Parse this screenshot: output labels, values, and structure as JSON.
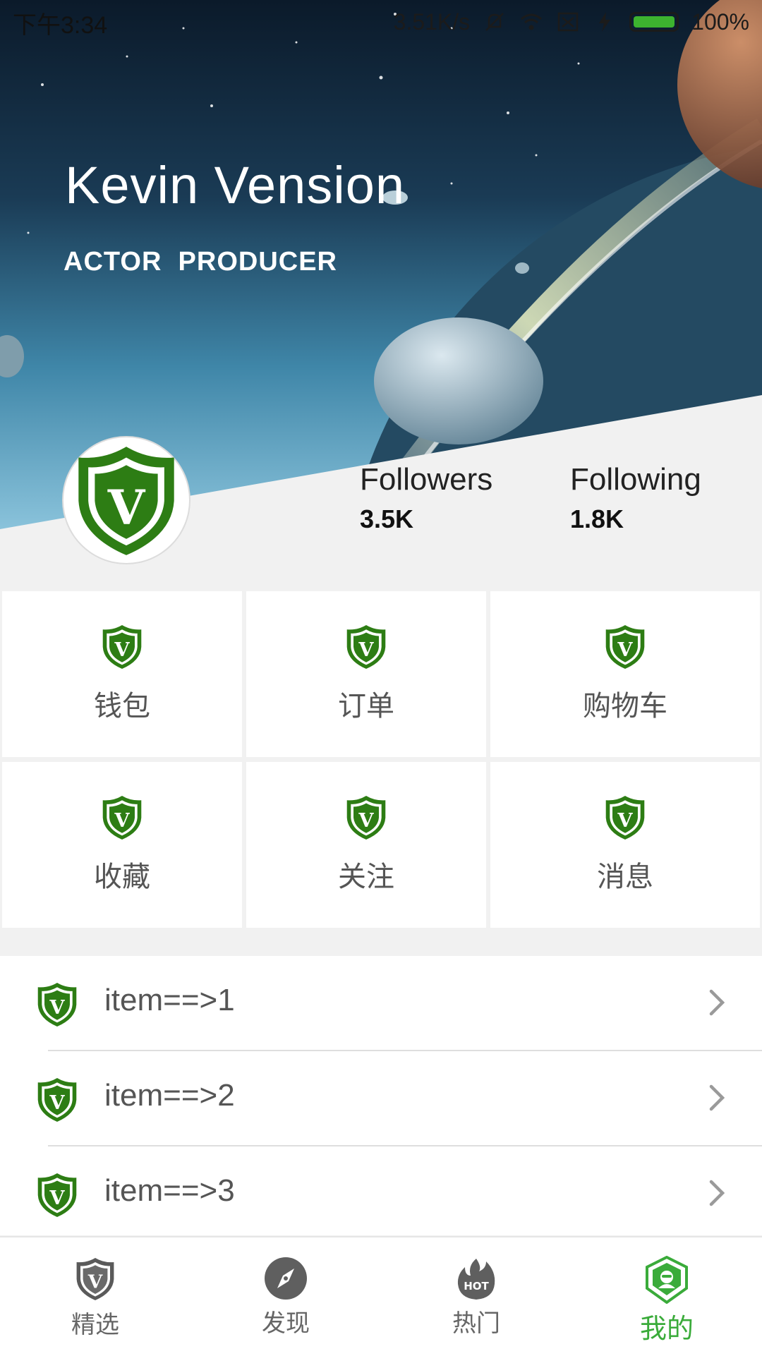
{
  "status_bar": {
    "time": "下午3:34",
    "network_speed": "3.51K/s",
    "battery": "100%",
    "icons": [
      "mute-icon",
      "wifi-icon",
      "sim-icon",
      "charging-icon",
      "battery-icon"
    ]
  },
  "profile": {
    "name": "Kevin Vension",
    "roles": "ACTOR  PRODUCER",
    "avatar_icon": "shield-v-icon",
    "followers_label": "Followers",
    "followers_value": "3.5K",
    "following_label": "Following",
    "following_value": "1.8K"
  },
  "grid": [
    {
      "label": "钱包",
      "icon": "shield-v-icon"
    },
    {
      "label": "订单",
      "icon": "shield-v-icon"
    },
    {
      "label": "购物车",
      "icon": "shield-v-icon"
    },
    {
      "label": "收藏",
      "icon": "shield-v-icon"
    },
    {
      "label": "关注",
      "icon": "shield-v-icon"
    },
    {
      "label": "消息",
      "icon": "shield-v-icon"
    }
  ],
  "list": [
    {
      "label": "item==>1",
      "icon": "shield-v-icon"
    },
    {
      "label": "item==>2",
      "icon": "shield-v-icon"
    },
    {
      "label": "item==>3",
      "icon": "shield-v-icon"
    }
  ],
  "bottom_nav": [
    {
      "label": "精选",
      "icon": "shield-v-icon",
      "active": false
    },
    {
      "label": "发现",
      "icon": "compass-icon",
      "active": false
    },
    {
      "label": "热门",
      "icon": "hot-icon",
      "active": false
    },
    {
      "label": "我的",
      "icon": "profile-shield-icon",
      "active": true
    }
  ],
  "colors": {
    "accent": "#3aab3a",
    "shield_green": "#2d7d14",
    "background": "#f1f1f1"
  }
}
